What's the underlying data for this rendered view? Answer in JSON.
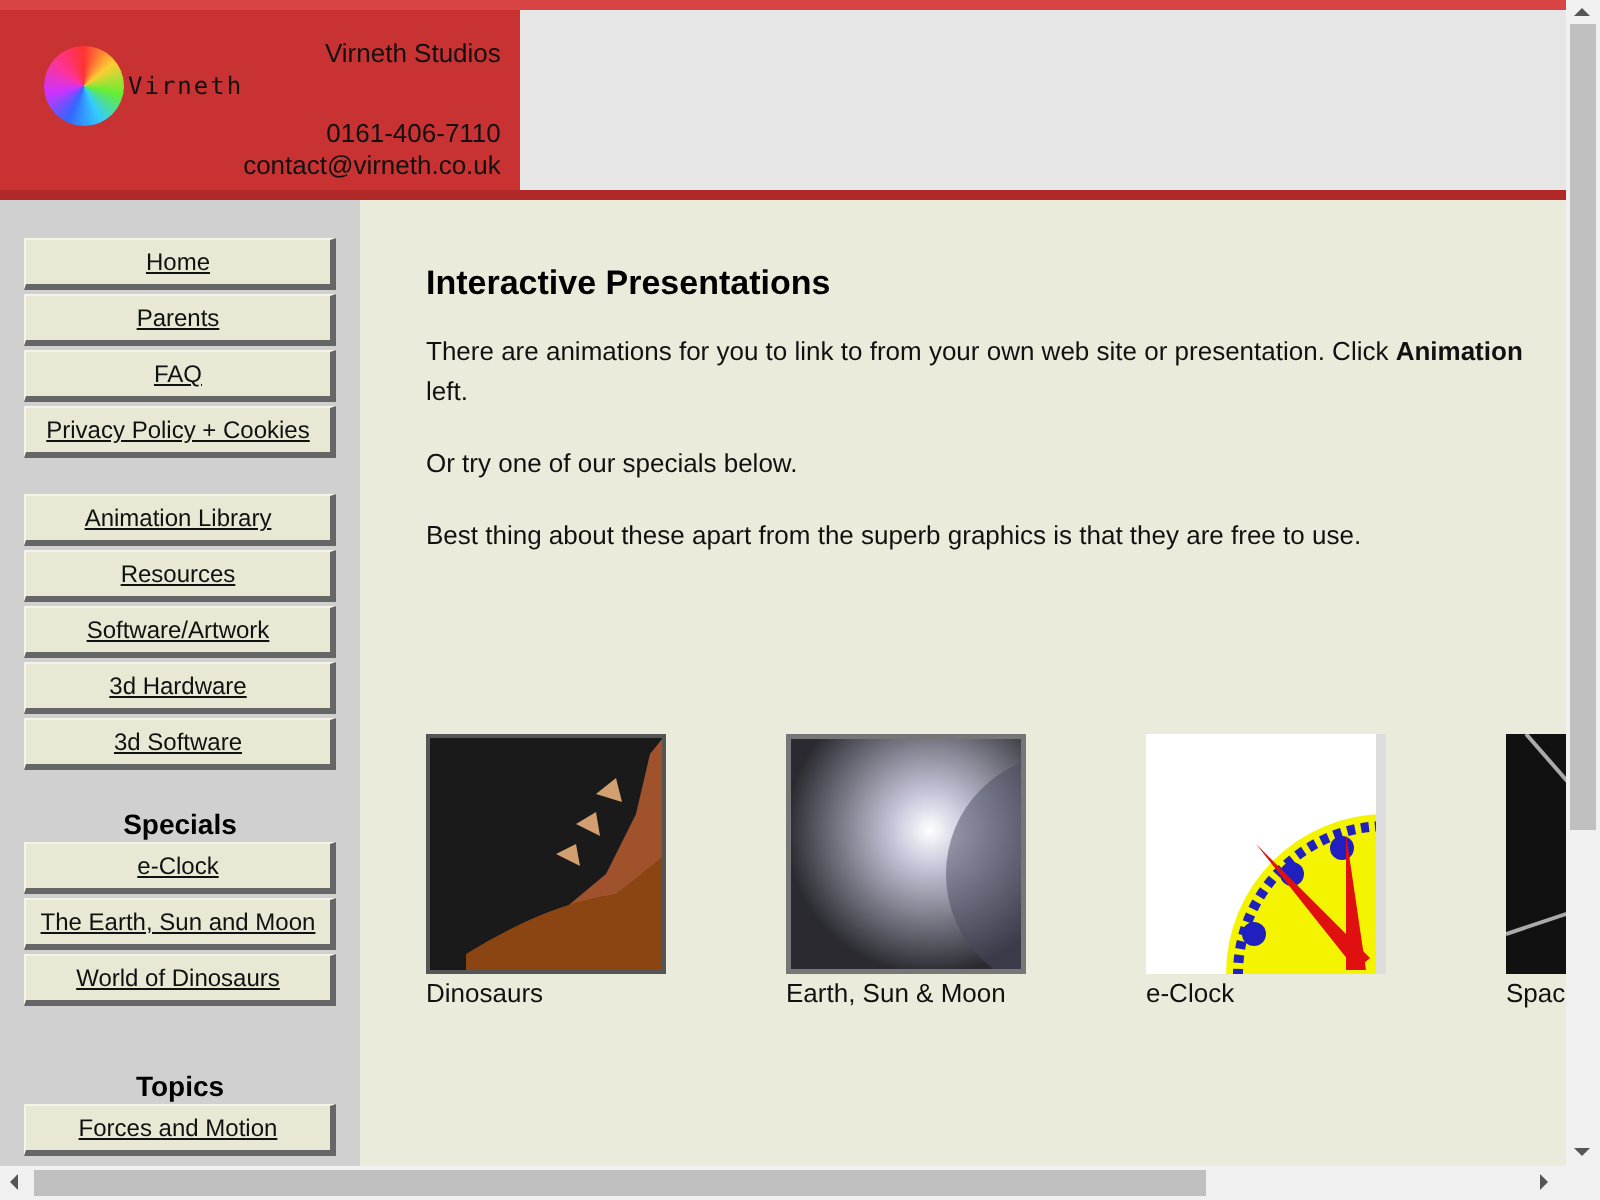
{
  "header": {
    "logo_text": "Virneth",
    "company": "Virneth Studios",
    "phone": "0161-406-7110",
    "email": "contact@virneth.co.uk"
  },
  "sidebar": {
    "groups": [
      {
        "items": [
          "Home",
          "Parents",
          "FAQ",
          "Privacy Policy + Cookies"
        ]
      },
      {
        "items": [
          "Animation Library",
          "Resources",
          "Software/Artwork",
          "3d Hardware",
          "3d Software"
        ]
      },
      {
        "heading": "Specials",
        "items": [
          "e-Clock",
          "The Earth, Sun and Moon",
          "World of Dinosaurs"
        ]
      },
      {
        "heading": "Topics",
        "items": [
          "Forces and Motion"
        ]
      }
    ]
  },
  "content": {
    "title": "Interactive Presentations",
    "paragraphs": [
      {
        "lines": [
          "There are animations for you to link to from your own web site or presentation. Click **Animation**",
          "left."
        ]
      },
      {
        "lines": [
          "Or try one of our specials below."
        ]
      },
      {
        "lines": [
          "Best thing about these apart from the superb graphics is that they are free to use."
        ]
      }
    ],
    "specials": [
      {
        "caption": "Dinosaurs"
      },
      {
        "caption": "Earth, Sun & Moon"
      },
      {
        "caption": "e-Clock"
      },
      {
        "caption": "Spac"
      }
    ]
  }
}
